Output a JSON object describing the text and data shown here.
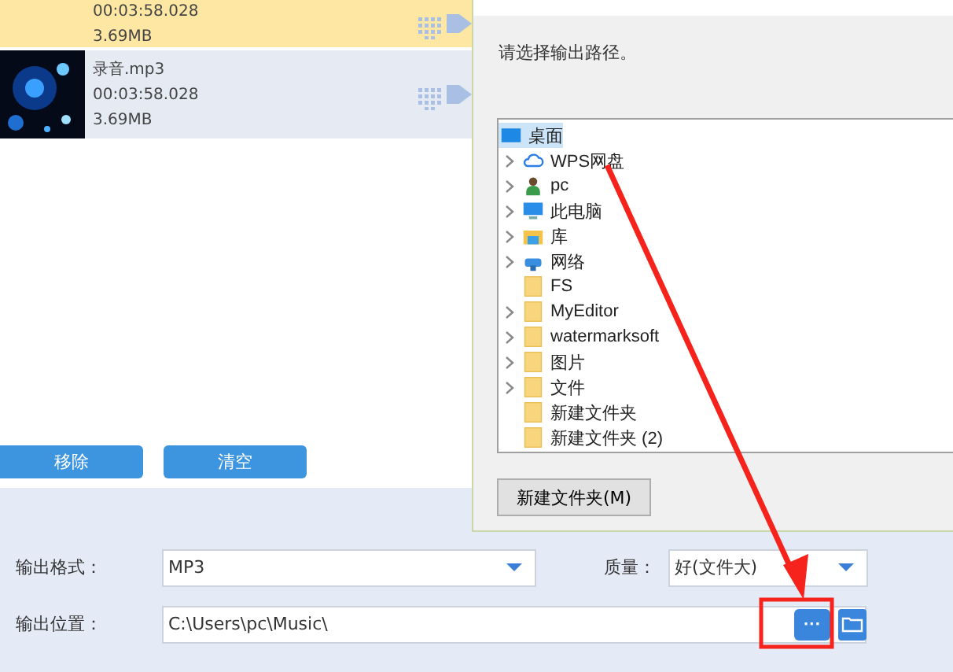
{
  "files": [
    {
      "duration": "00:03:58.028",
      "size": "3.69MB",
      "selected": true
    },
    {
      "name": "录音.mp3",
      "duration": "00:03:58.028",
      "size": "3.69MB",
      "selected": false
    }
  ],
  "list_buttons": [
    "移除",
    "清空"
  ],
  "output": {
    "format_label": "输出格式：",
    "format": "MP3",
    "quality_label": "质量：",
    "quality": "好(文件大)",
    "path_label": "输出位置：",
    "path": "C:\\Users\\pc\\Music\\",
    "browse_button": "···"
  },
  "dialog": {
    "message": "请选择输出路径。",
    "tree": [
      {
        "label": "桌面",
        "kind": "desktop",
        "selected": true,
        "children": [
          {
            "label": "WPS网盘",
            "kind": "cloud",
            "expandable": true,
            "selected": false
          },
          {
            "label": "pc",
            "kind": "user",
            "expandable": true,
            "selected": false
          },
          {
            "label": "此电脑",
            "kind": "computer",
            "expandable": true,
            "selected": false
          },
          {
            "label": "库",
            "kind": "library",
            "expandable": true,
            "selected": false
          },
          {
            "label": "网络",
            "kind": "network",
            "expandable": true,
            "selected": false
          },
          {
            "label": "FS",
            "kind": "folder",
            "expandable": false,
            "selected": false
          },
          {
            "label": "MyEditor",
            "kind": "folder",
            "expandable": true,
            "selected": false
          },
          {
            "label": "watermarksoft",
            "kind": "folder",
            "expandable": true,
            "selected": false
          },
          {
            "label": "图片",
            "kind": "folder",
            "expandable": true,
            "selected": false
          },
          {
            "label": "文件",
            "kind": "folder",
            "expandable": true,
            "selected": false
          },
          {
            "label": "新建文件夹",
            "kind": "folder",
            "expandable": false,
            "selected": false
          },
          {
            "label": "新建文件夹 (2)",
            "kind": "folder",
            "expandable": false,
            "selected": false
          }
        ]
      }
    ],
    "new_folder_button": "新建文件夹(M)"
  }
}
